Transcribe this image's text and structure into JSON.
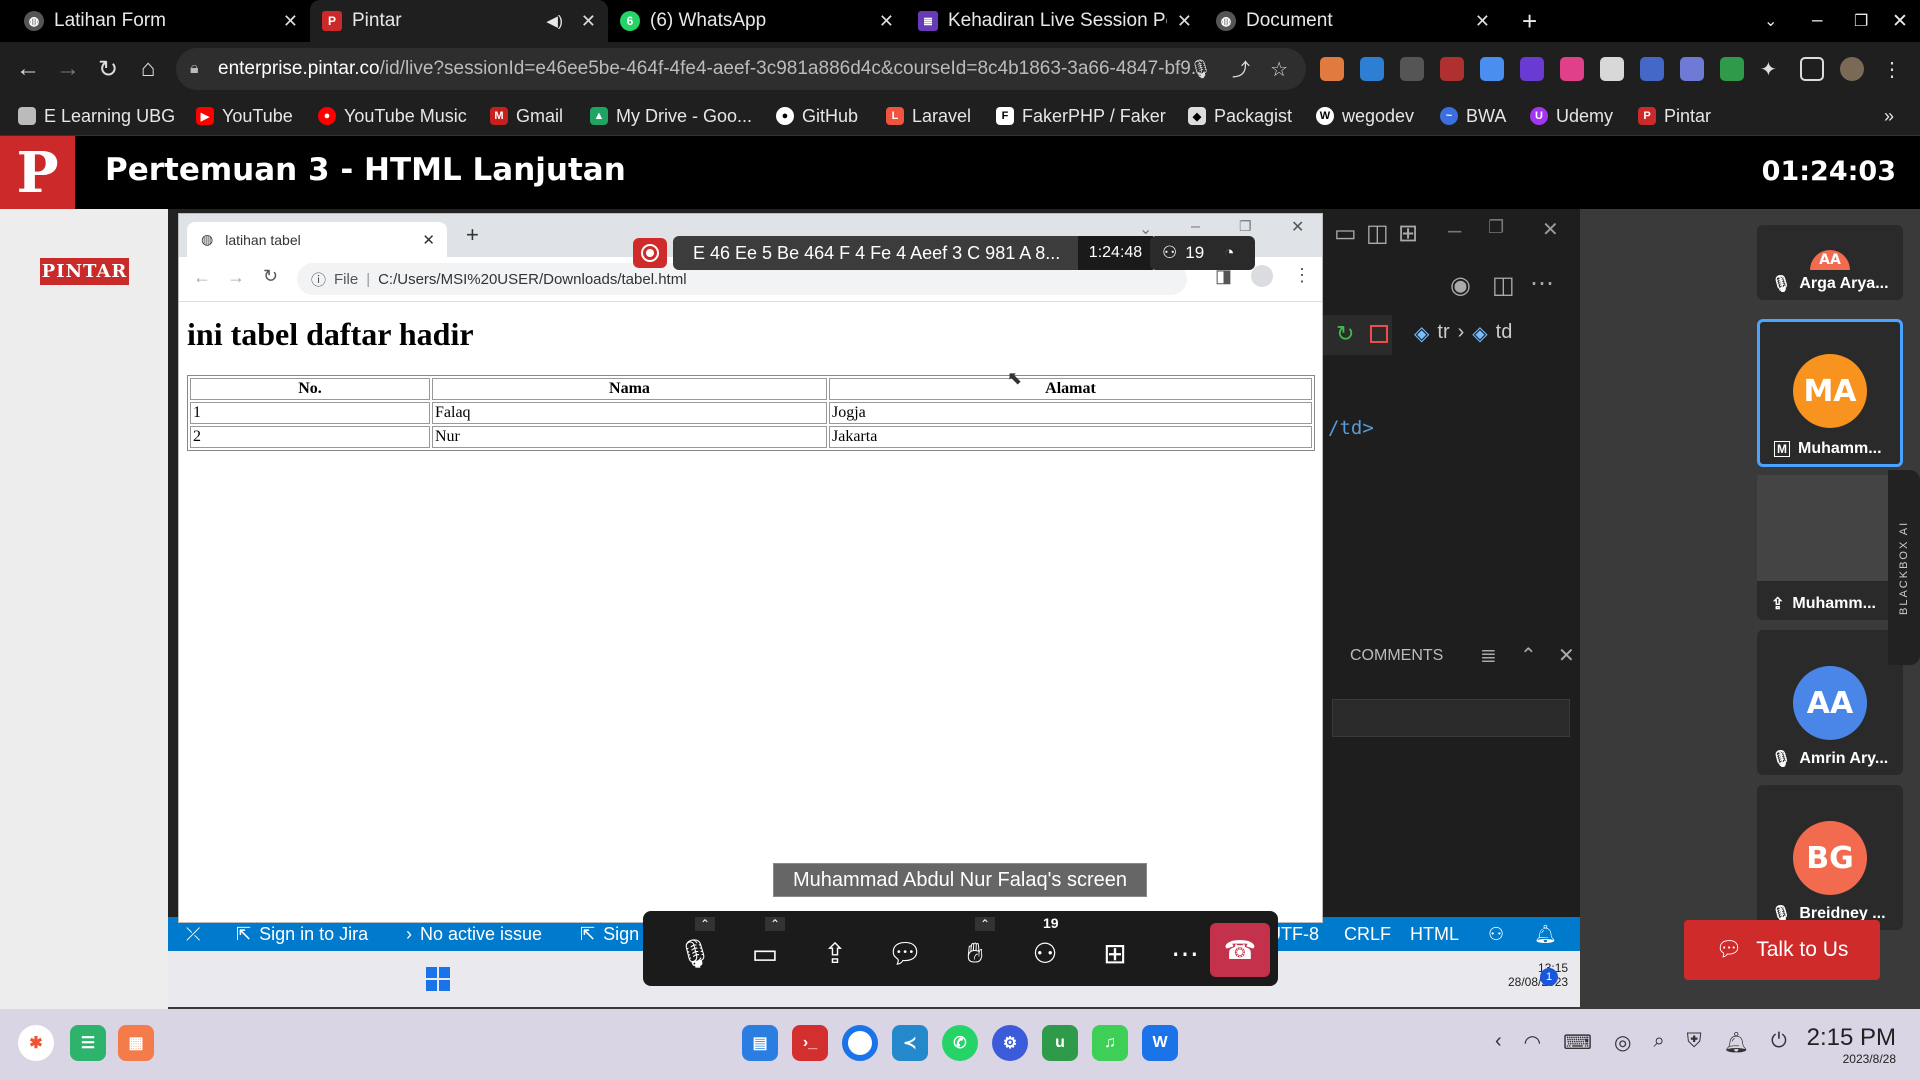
{
  "browser": {
    "tabs": [
      {
        "title": "Latihan Form",
        "icon": "globe-icon"
      },
      {
        "title": "Pintar",
        "icon": "pintar-icon"
      },
      {
        "title": "(6) WhatsApp",
        "icon": "whatsapp-icon",
        "badge": "6"
      },
      {
        "title": "Kehadiran Live Session Pe",
        "icon": "forms-icon"
      },
      {
        "title": "Document",
        "icon": "globe-icon"
      }
    ],
    "url_host": "enterprise.pintar.co",
    "url_path": "/id/live?sessionId=e46ee5be-464f-4fe4-aeef-3c981a886d4c&courseId=8c4b1863-3a66-4847-bf9...",
    "bookmarks": [
      "E Learning UBG",
      "YouTube",
      "YouTube Music",
      "Gmail",
      "My Drive - Goo...",
      "GitHub",
      "Laravel",
      "FakerPHP / Faker",
      "Packagist",
      "wegodev",
      "BWA",
      "Udemy",
      "Pintar"
    ],
    "more": "»"
  },
  "session": {
    "title": "Pertemuan 3 - HTML Lanjutan",
    "timer": "01:24:03",
    "badge": "PINTAR"
  },
  "meeting": {
    "session_name": "E 46 Ee 5 Be 464 F 4 Fe 4 Aeef 3 C 981 A 8...",
    "elapsed": "1:24:48",
    "participant_count": "19",
    "screen_label": "Muhammad Abdul Nur Falaq's screen",
    "participants": [
      {
        "initials": "AA",
        "name": "Arga Arya...",
        "color": "#f26b4f"
      },
      {
        "initials": "MA",
        "name": "Muhamm...",
        "color": "#f7931e"
      },
      {
        "initials": "",
        "name": "Muhamm..."
      },
      {
        "initials": "AA",
        "name": "Amrin Ary...",
        "color": "#4a86e8"
      },
      {
        "initials": "BG",
        "name": "Breidney ...",
        "color": "#f26b4f"
      }
    ],
    "talk_button": "Talk to Us",
    "blackbox": "BLACKBOX AI"
  },
  "inner_browser": {
    "tab_title": "latihan tabel",
    "file_label": "File",
    "path": "C:/Users/MSI%20USER/Downloads/tabel.html",
    "page_heading": "ini tabel daftar hadir",
    "table": {
      "headers": [
        "No.",
        "Nama",
        "Alamat"
      ],
      "rows": [
        [
          "1",
          "Falaq",
          "Jogja"
        ],
        [
          "2",
          "Nur",
          "Jakarta"
        ]
      ]
    }
  },
  "vscode": {
    "breadcrumb_tr": "tr",
    "breadcrumb_td": "td",
    "code_tail": "/td>",
    "comments": "COMMENTS",
    "status": [
      "Sign in to Jira",
      "No active issue",
      "Sign",
      "UTF-8",
      "CRLF",
      "HTML"
    ],
    "taskbar_time": "13:15",
    "taskbar_date": "28/08/2023"
  },
  "os": {
    "time": "2:15 PM",
    "date": "2023/8/28"
  }
}
